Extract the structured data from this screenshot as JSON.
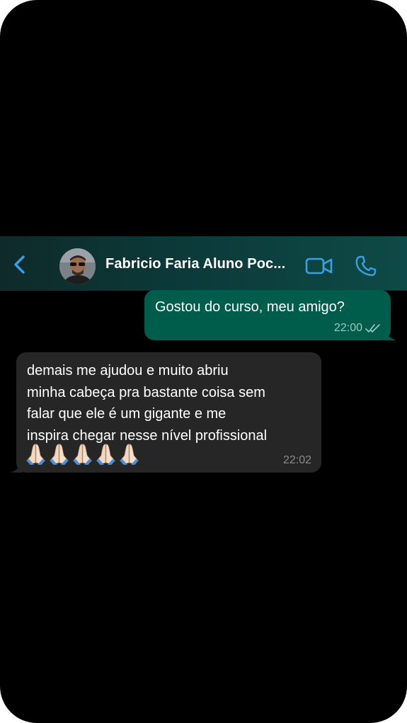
{
  "chat": {
    "contact_name": "Fabricio Faria Aluno Poc...",
    "colors": {
      "accent": "#3aa0e6",
      "outgoing_bubble": "#005c4b",
      "incoming_bubble": "#262626",
      "background": "#000000"
    }
  },
  "icons": {
    "back": "chevron-left-icon",
    "video": "video-camera-icon",
    "call": "phone-icon",
    "read": "double-check-icon",
    "emoji": "folded-hands-emoji"
  },
  "messages": {
    "outgoing": {
      "text": "Gostou do curso, meu amigo?",
      "time": "22:00"
    },
    "incoming": {
      "text": "demais me ajudou e muito abriu\nminha cabeça pra bastante coisa sem\nfalar que ele é um gigante e me\ninspira chegar nesse nível profissional",
      "emoji_count": 5,
      "time": "22:02"
    }
  }
}
